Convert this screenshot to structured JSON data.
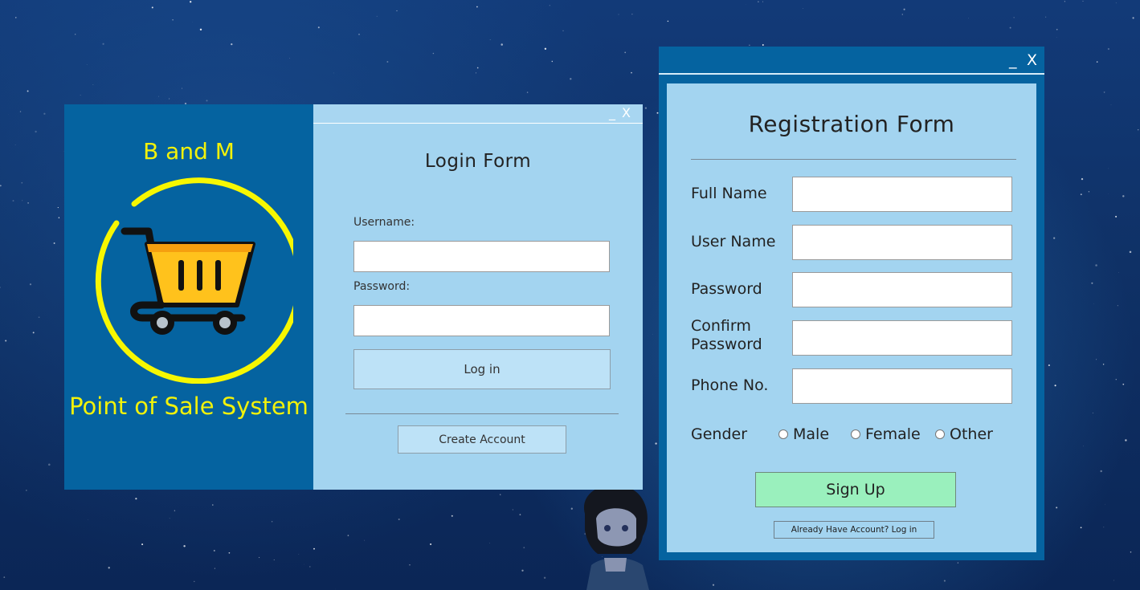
{
  "colors": {
    "brand_panel": "#0563a0",
    "form_panel": "#a3d4f0",
    "brand_text": "#f2f20a",
    "signup_button": "#9af0bd",
    "button": "#bde2f7"
  },
  "login_window": {
    "minimize_label": "_",
    "close_label": "X",
    "brand_title": "B and M",
    "brand_logo_icon": "shopping-cart-icon",
    "brand_subtitle": "Point of Sale System",
    "form_title": "Login Form",
    "username_label": "Username:",
    "username_value": "",
    "password_label": "Password:",
    "password_value": "",
    "login_button": "Log in",
    "create_account_button": "Create Account"
  },
  "registration_window": {
    "minimize_label": "_",
    "close_label": "X",
    "form_title": "Registration Form",
    "fields": {
      "full_name": {
        "label": "Full Name",
        "value": ""
      },
      "user_name": {
        "label": "User Name",
        "value": ""
      },
      "password": {
        "label": "Password",
        "value": ""
      },
      "confirm_password": {
        "label": "Confirm Password",
        "value": ""
      },
      "phone": {
        "label": "Phone No.",
        "value": ""
      }
    },
    "gender_label": "Gender",
    "gender_options": [
      "Male",
      "Female",
      "Other"
    ],
    "signup_button": "Sign Up",
    "have_account_button": "Already Have Account? Log in"
  }
}
